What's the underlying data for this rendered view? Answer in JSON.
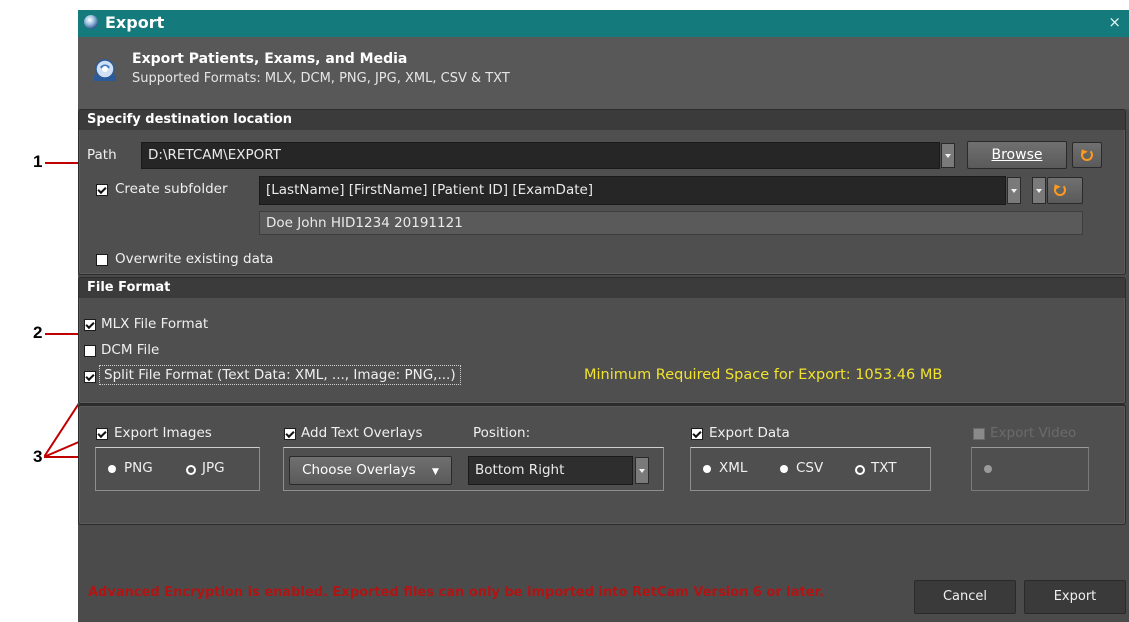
{
  "annotations": [
    "1",
    "2",
    "3"
  ],
  "window": {
    "title": "Export",
    "close_glyph": "×",
    "header_title": "Export Patients, Exams, and Media",
    "header_subtitle": "Supported Formats: MLX, DCM, PNG, JPG, XML, CSV & TXT"
  },
  "destination": {
    "section_title": "Specify destination location",
    "path_label": "Path",
    "path_value": "D:\\RETCAM\\EXPORT",
    "browse_label": "Browse",
    "create_subfolder_label": "Create subfolder",
    "create_subfolder_checked": true,
    "subfolder_pattern": "[LastName] [FirstName] [Patient ID] [ExamDate]",
    "subfolder_preview": "Doe John HID1234 20191121",
    "overwrite_label": "Overwrite existing data",
    "overwrite_checked": false
  },
  "file_format": {
    "section_title": "File Format",
    "mlx_label": "MLX File Format",
    "mlx_checked": true,
    "dcm_label": "DCM File",
    "dcm_checked": false,
    "split_label": "Split File Format (Text Data: XML, ..., Image: PNG,...)",
    "split_checked": true,
    "space_required": "Minimum Required Space for Export: 1053.46 MB"
  },
  "split_options": {
    "export_images_label": "Export Images",
    "image_formats": [
      "PNG",
      "JPG"
    ],
    "image_selected": "PNG",
    "add_overlays_label": "Add Text Overlays",
    "choose_overlays_label": "Choose Overlays",
    "position_label": "Position:",
    "position_value": "Bottom Right",
    "export_data_label": "Export Data",
    "data_formats": [
      "XML",
      "CSV",
      "TXT"
    ],
    "data_selected": [
      "XML",
      "CSV"
    ],
    "export_video_label": "Export Video"
  },
  "footer": {
    "encryption_warning": "Advanced Encryption is enabled. Exported files can only be imported into RetCam Version 6 or later.",
    "cancel_label": "Cancel",
    "export_label": "Export"
  },
  "colors": {
    "titlebar": "#157a7c",
    "warning": "#b21414",
    "highlight_text": "#f2e22d",
    "annotation_line": "#c00000"
  }
}
